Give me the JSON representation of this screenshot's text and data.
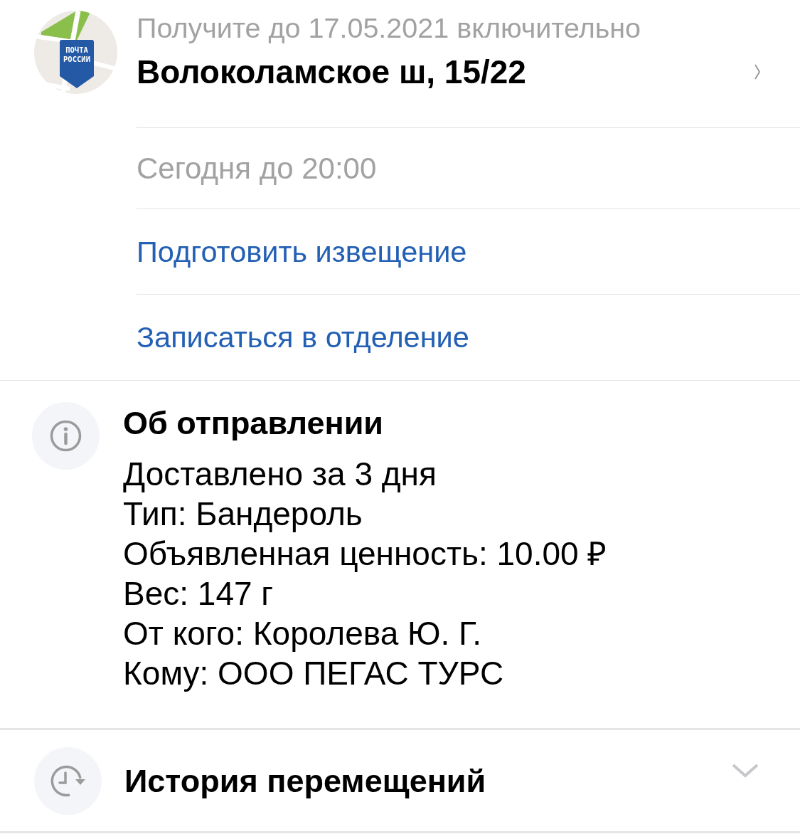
{
  "office": {
    "logo_text": [
      "ПОЧТА",
      "РОССИИ"
    ],
    "pickup_deadline": "Получите до 17.05.2021 включительно",
    "address": "Волоколамское ш, 15/22",
    "hours": "Сегодня до 20:00",
    "actions": [
      "Подготовить извещение",
      "Записаться в отделение"
    ]
  },
  "about": {
    "title": "Об отправлении",
    "lines": [
      "Доставлено за 3 дня",
      "Тип: Бандероль",
      "Объявленная ценность: 10.00 ₽",
      "Вес: 147 г",
      "От кого: Королева Ю. Г.",
      "Кому: ООО ПЕГАС ТУРС"
    ]
  },
  "history": {
    "title": "История перемещений",
    "expanded": false
  }
}
